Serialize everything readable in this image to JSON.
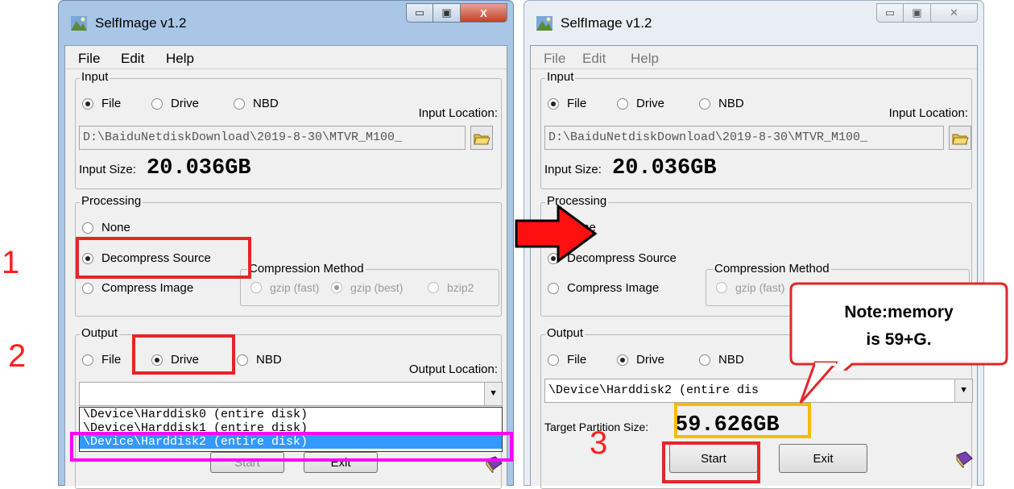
{
  "windows": [
    {
      "title": "SelfImage v1.2",
      "caption": {
        "minimize": "▭",
        "maximize": "▣",
        "close": "X"
      },
      "menu": [
        "File",
        "Edit",
        "Help"
      ],
      "input": {
        "group_label": "Input",
        "radios": [
          {
            "label": "File",
            "checked": true
          },
          {
            "label": "Drive",
            "checked": false
          },
          {
            "label": "NBD",
            "checked": false
          }
        ],
        "location_label": "Input Location:",
        "path": "D:\\BaiduNetdiskDownload\\2019-8-30\\MTVR_M100_",
        "size_label": "Input Size:",
        "size_value": "20.036GB"
      },
      "processing": {
        "group_label": "Processing",
        "none": "None",
        "decompress": "Decompress Source",
        "compress": "Compress Image",
        "method_label": "Compression Method",
        "methods": [
          "gzip (fast)",
          "gzip (best)",
          "bzip2"
        ]
      },
      "output": {
        "group_label": "Output",
        "radios": [
          {
            "label": "File",
            "checked": false
          },
          {
            "label": "Drive",
            "checked": true
          },
          {
            "label": "NBD",
            "checked": false
          }
        ],
        "location_label": "Output Location:",
        "combo_value": "",
        "dropdown_items": [
          "\\Device\\Harddisk0 (entire disk)",
          "\\Device\\Harddisk1 (entire disk)",
          "\\Device\\Harddisk2 (entire disk)"
        ],
        "selected_index": 2
      },
      "buttons": {
        "start": "Start",
        "exit": "Exit"
      }
    },
    {
      "title": "SelfImage v1.2",
      "caption": {
        "minimize": "▭",
        "maximize": "▣",
        "close": "✕"
      },
      "menu": [
        "File",
        "Edit",
        "Help"
      ],
      "input": {
        "group_label": "Input",
        "radios": [
          {
            "label": "File",
            "checked": true
          },
          {
            "label": "Drive",
            "checked": false
          },
          {
            "label": "NBD",
            "checked": false
          }
        ],
        "location_label": "Input Location:",
        "path": "D:\\BaiduNetdiskDownload\\2019-8-30\\MTVR_M100_",
        "size_label": "Input Size:",
        "size_value": "20.036GB"
      },
      "processing": {
        "group_label": "Processing",
        "none": "None",
        "decompress": "Decompress Source",
        "compress": "Compress Image",
        "method_label": "Compression Method",
        "methods": [
          "gzip (fast)"
        ]
      },
      "output": {
        "group_label": "Output",
        "radios": [
          {
            "label": "File",
            "checked": false
          },
          {
            "label": "Drive",
            "checked": true
          },
          {
            "label": "NBD",
            "checked": false
          }
        ],
        "combo_value": "\\Device\\Harddisk2 (entire dis",
        "target_label": "Target Partition Size:",
        "target_value": "59.626GB"
      },
      "buttons": {
        "start": "Start",
        "exit": "Exit"
      }
    }
  ],
  "annotations": {
    "step1": "1",
    "step2": "2",
    "step3": "3",
    "callout_line1": "Note:memory",
    "callout_line2": "is 59+G.",
    "colors": {
      "highlight": "#e32626",
      "selection_box": "#ff00ff",
      "target_box": "#f5bc00",
      "arrow": "#ff1010"
    }
  }
}
